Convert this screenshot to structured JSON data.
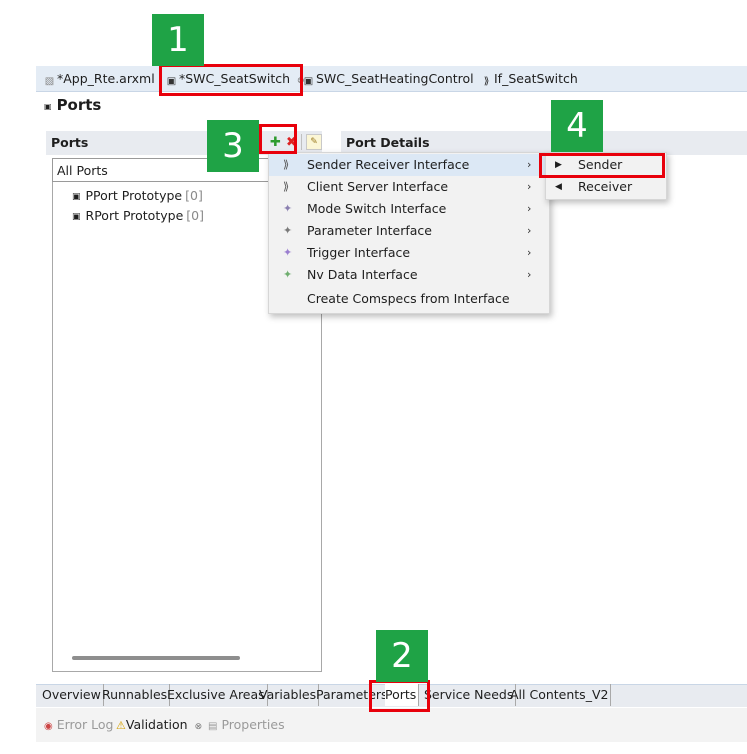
{
  "editor_tabs": [
    {
      "label": "*App_Rte.arxml",
      "icon": "arxml-file-icon"
    },
    {
      "label": "*SWC_SeatSwitch",
      "icon": "component-icon",
      "close": "⊗"
    },
    {
      "label": "SWC_SeatHeatingControl",
      "icon": "component-icon"
    },
    {
      "label": "If_SeatSwitch",
      "icon": "sender-receiver-interface-icon"
    }
  ],
  "page_title": "Ports",
  "ports_panel": {
    "header": "Ports",
    "filter_value": "All Ports",
    "tree": [
      {
        "label": "PPort Prototype",
        "count": "[0]"
      },
      {
        "label": "RPort Prototype",
        "count": "[0]"
      }
    ]
  },
  "toolbar": {
    "add_icon": "✚",
    "remove_icon": "✖",
    "edit_icon": "✎"
  },
  "details_header": "Port Details",
  "context_menu": [
    {
      "label": "Sender Receiver Interface",
      "icon": "⟫",
      "submenu": true,
      "highlighted": true
    },
    {
      "label": "Client Server Interface",
      "icon": "⟫",
      "submenu": true
    },
    {
      "label": "Mode Switch Interface",
      "icon": "✦",
      "submenu": true
    },
    {
      "label": "Parameter Interface",
      "icon": "✦",
      "submenu": true
    },
    {
      "label": "Trigger Interface",
      "icon": "✦",
      "submenu": true
    },
    {
      "label": "Nv Data Interface",
      "icon": "✦",
      "submenu": true
    },
    {
      "label": "Create Comspecs from Interface",
      "icon": "",
      "submenu": false
    }
  ],
  "submenu": [
    {
      "label": "Sender",
      "icon": "▶"
    },
    {
      "label": "Receiver",
      "icon": "◀"
    }
  ],
  "bottom_tabs": [
    "Overview",
    "Runnables",
    "Exclusive Areas",
    "Variables",
    "Parameters",
    "Ports",
    "Service Needs",
    "All Contents_V2"
  ],
  "active_bottom_tab": "Ports",
  "view_tabs": [
    {
      "label": "Error Log",
      "icon": "error-log-icon"
    },
    {
      "label": "Validation",
      "icon": "validation-icon",
      "close": "⊗"
    },
    {
      "label": "Properties",
      "icon": "properties-icon"
    }
  ],
  "annotations": [
    "1",
    "2",
    "3",
    "4"
  ],
  "colors": {
    "badge": "#1fa346",
    "highlight": "#e8000b",
    "tabbar": "#e4ecf5",
    "menu_hover": "#dce8f5"
  }
}
